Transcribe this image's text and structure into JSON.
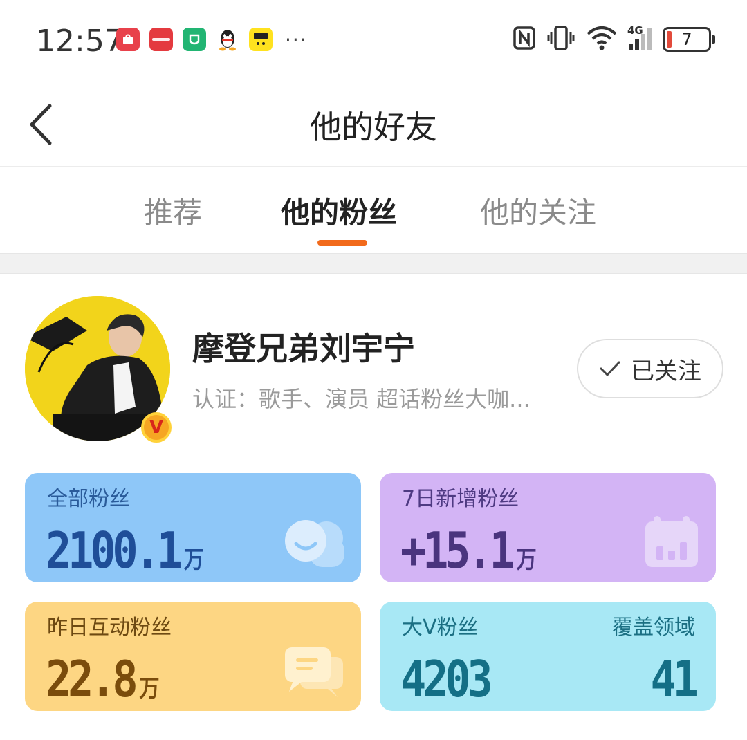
{
  "status_bar": {
    "time": "12:57",
    "notification_apps": [
      "huawei-store",
      "jd-app",
      "mijia-app",
      "qq-app",
      "xianyu-app"
    ],
    "more_indicator": "···",
    "network": "4G",
    "battery_level": "7"
  },
  "header": {
    "title": "他的好友"
  },
  "tabs": [
    {
      "label": "推荐",
      "active": false
    },
    {
      "label": "他的粉丝",
      "active": true
    },
    {
      "label": "他的关注",
      "active": false
    }
  ],
  "profile": {
    "name": "摩登兄弟刘宇宁",
    "verification": "认证：歌手、演员 超话粉丝大咖...",
    "badge": "V",
    "follow_button": "已关注"
  },
  "stats": {
    "all_fans": {
      "label": "全部粉丝",
      "value": "2100.1",
      "unit": "万"
    },
    "new_7d": {
      "label": "7日新增粉丝",
      "value": "+15.1",
      "unit": "万"
    },
    "interact_yesterday": {
      "label": "昨日互动粉丝",
      "value": "22.8",
      "unit": "万"
    },
    "big_v": {
      "label": "大V粉丝",
      "value": "4203",
      "coverage_label": "覆盖领域",
      "coverage_value": "41"
    }
  },
  "colors": {
    "accent": "#f26a1b",
    "card_blue": "#8ec7f8",
    "card_purple": "#d3b4f5",
    "card_yellow": "#fdd683",
    "card_cyan": "#a8e8f5"
  }
}
